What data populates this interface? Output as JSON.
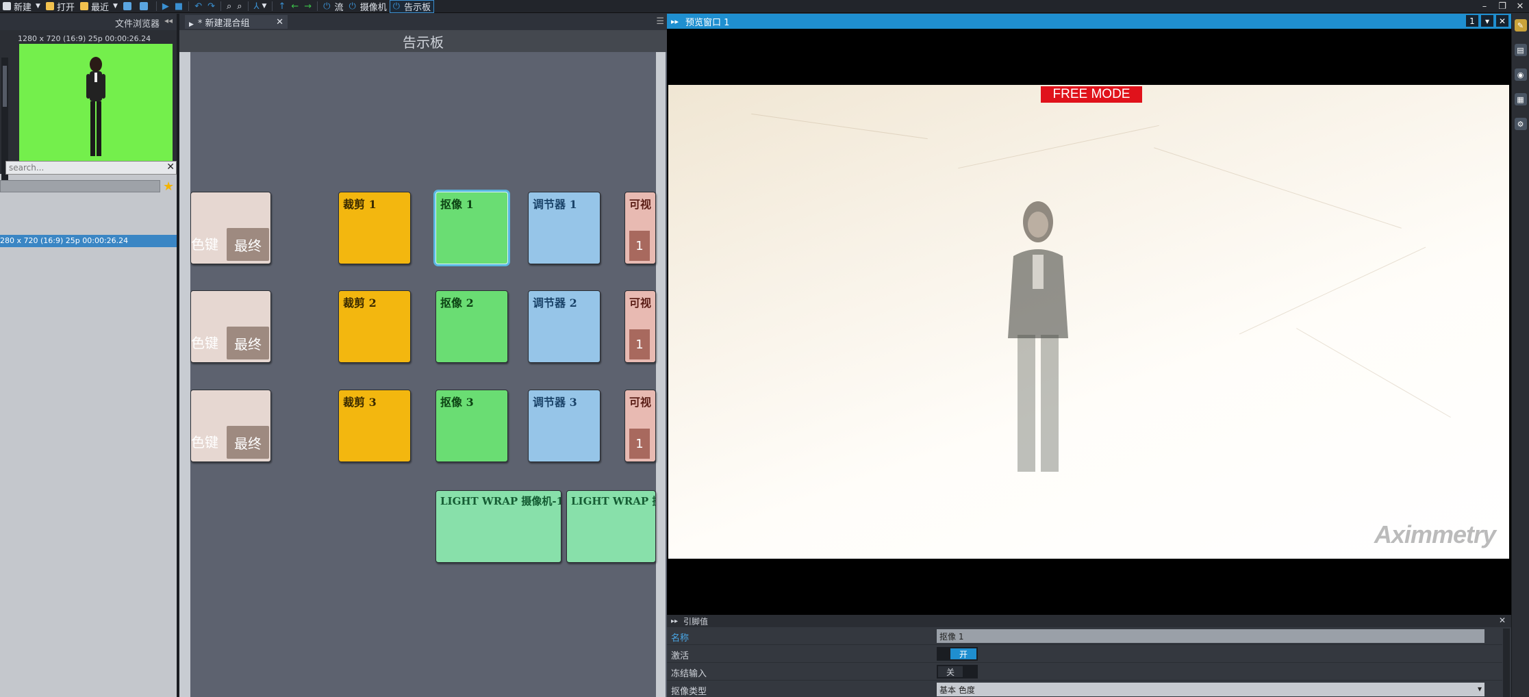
{
  "toolbar": {
    "items": [
      {
        "label": "新建",
        "icon": "new-file-icon"
      },
      {
        "label": "打开",
        "icon": "folder-icon"
      },
      {
        "label": "最近",
        "icon": "recent-icon"
      }
    ],
    "tabs": [
      {
        "label": "流",
        "icon": "power-icon"
      },
      {
        "label": "摄像机",
        "icon": "power-icon"
      },
      {
        "label": "告示板",
        "icon": "power-icon",
        "active": true
      }
    ]
  },
  "file_browser": {
    "title": "文件浏览器",
    "clip_meta": "1280 x 720 (16:9) 25p  00:00:26.24",
    "search_placeholder": "search...",
    "selected_row": "280 x 720 (16:9) 25p  00:00:26.24"
  },
  "compound": {
    "tab_label": "* 新建混合组",
    "board_title": "告示板",
    "final_ghost": "色键",
    "final_button": "最终",
    "crop_nodes": [
      "裁剪 1",
      "裁剪 2",
      "裁剪 3"
    ],
    "key_nodes": [
      "抠像 1",
      "抠像 2",
      "抠像 3"
    ],
    "adj_nodes": [
      "调节器 1",
      "调节器 2",
      "调节器 3"
    ],
    "vis_nodes": [
      "可视",
      "可视",
      "可视"
    ],
    "vis_number": "1",
    "lightwrap_nodes": [
      "LIGHT WRAP 摄像机-1",
      "LIGHT WRAP 摄"
    ]
  },
  "preview": {
    "title": "预览窗口 1",
    "window_number": "1",
    "badge": "FREE MODE",
    "watermark": "Aximmetry"
  },
  "properties": {
    "title": "引脚值",
    "rows": [
      {
        "label": "名称",
        "value": "抠像 1"
      },
      {
        "label": "激活",
        "value": "开"
      },
      {
        "label": "冻结输入",
        "value": "关"
      },
      {
        "label": "抠像类型",
        "value": "基本 色度"
      }
    ]
  },
  "colors": {
    "accent": "#1f8fd0",
    "crop": "#f3b70f",
    "key": "#6add73",
    "adjuster": "#96c5e8",
    "visible": "#e8bab2",
    "lightwrap": "#88e0aa",
    "green_screen": "#74ef4c",
    "free_mode": "#e0121b"
  }
}
